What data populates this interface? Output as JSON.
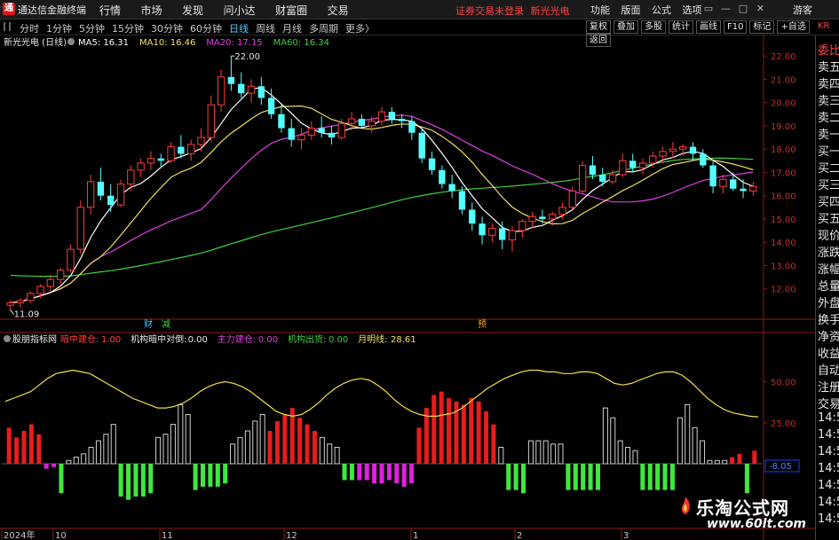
{
  "titlebar": {
    "app_name": "通达信金融终端",
    "logo_glyph": "通",
    "menu": [
      "行情",
      "市场",
      "发现",
      "问小达",
      "财富圈",
      "交易"
    ],
    "login_warning": "证券交易未登录",
    "stock_name": "新光光电",
    "right_menu": [
      "功能",
      "版面",
      "公式",
      "选项"
    ],
    "window_controls": [
      "▭",
      "—",
      "□",
      "✕"
    ],
    "guest": "游客"
  },
  "periodbar": {
    "periods": [
      "分时",
      "1分钟",
      "5分钟",
      "15分钟",
      "30分钟",
      "60分钟",
      "日线",
      "周线",
      "月线",
      "多周期",
      "更多〉"
    ],
    "active_period": "日线",
    "tools": [
      "复权",
      "叠加",
      "多股",
      "统计",
      "画线",
      "F10",
      "标记",
      "+自选",
      "返回"
    ]
  },
  "main_chart": {
    "stock_label": "新光光电 (日线)",
    "ma_labels": [
      {
        "text": "MA5: 16.31",
        "color": "#ffffff"
      },
      {
        "text": "MA10: 16.46",
        "color": "#f0e060"
      },
      {
        "text": "MA20: 17.15",
        "color": "#e040e0"
      },
      {
        "text": "MA60: 16.34",
        "color": "#40d040"
      }
    ],
    "high_label": "22.00",
    "low_label": "11.09",
    "event_markers": [
      {
        "text": "财",
        "color": "#4ec0ff"
      },
      {
        "text": "减",
        "color": "#40d040"
      },
      {
        "text": "预",
        "color": "#e8a020"
      }
    ],
    "y_ticks": [
      "22.00",
      "21.00",
      "20.00",
      "19.00",
      "18.00",
      "17.00",
      "16.00",
      "15.00",
      "14.00",
      "13.00",
      "12.00"
    ]
  },
  "indicator": {
    "name": "股朋指标网",
    "items": [
      {
        "label": "暗中建仓:",
        "value": "1.00",
        "color": "#ff4040"
      },
      {
        "label": "机构暗中对倒:",
        "value": "0.00",
        "color": "#e6e6e6"
      },
      {
        "label": "主力建仓:",
        "value": "0.00",
        "color": "#e040e0"
      },
      {
        "label": "机构出货:",
        "value": "0.00",
        "color": "#40d040"
      },
      {
        "label": "月明线:",
        "value": "28.61",
        "color": "#f0e060"
      }
    ],
    "y_ticks": [
      "50.00",
      "25.00"
    ],
    "current_value": "-8.05"
  },
  "x_axis": [
    "2024年",
    "10",
    "11",
    "12",
    "1",
    "2",
    "3"
  ],
  "side_panel": {
    "kr_label": "KR",
    "items": [
      {
        "text": "委比",
        "red": true
      },
      {
        "text": "卖五",
        "red": false
      },
      {
        "text": "卖四",
        "red": false
      },
      {
        "text": "卖三",
        "red": false
      },
      {
        "text": "卖二",
        "red": false
      },
      {
        "text": "卖一",
        "red": false
      },
      {
        "text": "买一",
        "red": false
      },
      {
        "text": "买二",
        "red": false
      },
      {
        "text": "买三",
        "red": false
      },
      {
        "text": "买四",
        "red": false
      },
      {
        "text": "买五",
        "red": false
      },
      {
        "text": "现价",
        "red": false
      },
      {
        "text": "涨跌",
        "red": false
      },
      {
        "text": "涨幅",
        "red": false
      },
      {
        "text": "总量",
        "red": false
      },
      {
        "text": "外盘",
        "red": false
      },
      {
        "text": "换手",
        "red": false
      },
      {
        "text": "净资",
        "red": false
      },
      {
        "text": "收益",
        "red": false
      },
      {
        "text": "自动",
        "red": false
      },
      {
        "text": "注册",
        "red": false
      },
      {
        "text": "交易",
        "red": false
      },
      {
        "text": "14:54",
        "red": false
      },
      {
        "text": "14:54",
        "red": false
      },
      {
        "text": "14:54",
        "red": false
      },
      {
        "text": "14:54",
        "red": false
      },
      {
        "text": "14:55",
        "red": false
      },
      {
        "text": "14:55",
        "red": false
      },
      {
        "text": "14:55",
        "red": false
      }
    ]
  },
  "watermark": {
    "line1": "乐淘公式网",
    "line2": "www.60lt.com"
  },
  "chart_data": {
    "type": "candlestick",
    "y_range": [
      11.0,
      22.5
    ],
    "candles": [
      [
        11.3,
        11.5,
        11.1,
        11.4
      ],
      [
        11.4,
        11.6,
        11.2,
        11.5
      ],
      [
        11.5,
        11.9,
        11.4,
        11.8
      ],
      [
        11.8,
        12.2,
        11.6,
        12.1
      ],
      [
        12.1,
        12.6,
        11.9,
        12.4
      ],
      [
        12.4,
        12.9,
        12.2,
        12.8
      ],
      [
        12.8,
        13.9,
        12.7,
        13.7
      ],
      [
        13.7,
        15.8,
        13.5,
        15.5
      ],
      [
        15.5,
        16.9,
        15.2,
        16.6
      ],
      [
        16.6,
        17.2,
        15.8,
        16.0
      ],
      [
        16.0,
        16.5,
        15.3,
        15.6
      ],
      [
        15.6,
        16.7,
        15.5,
        16.5
      ],
      [
        16.5,
        17.3,
        16.2,
        17.1
      ],
      [
        17.1,
        17.6,
        16.8,
        17.4
      ],
      [
        17.4,
        17.9,
        17.1,
        17.6
      ],
      [
        17.6,
        17.8,
        17.2,
        17.5
      ],
      [
        17.5,
        18.3,
        17.4,
        18.1
      ],
      [
        18.1,
        18.6,
        17.6,
        17.8
      ],
      [
        17.8,
        18.4,
        17.5,
        18.2
      ],
      [
        18.2,
        18.9,
        17.9,
        18.5
      ],
      [
        18.5,
        20.3,
        18.3,
        19.9
      ],
      [
        19.9,
        21.4,
        19.6,
        21.1
      ],
      [
        21.1,
        22.0,
        20.5,
        20.8
      ],
      [
        20.8,
        21.3,
        20.2,
        20.4
      ],
      [
        20.4,
        21.0,
        20.0,
        20.7
      ],
      [
        20.7,
        21.1,
        19.9,
        20.2
      ],
      [
        20.2,
        20.6,
        19.3,
        19.5
      ],
      [
        19.5,
        19.9,
        18.7,
        18.9
      ],
      [
        18.9,
        19.3,
        18.1,
        18.4
      ],
      [
        18.4,
        18.9,
        18.0,
        18.6
      ],
      [
        18.6,
        19.2,
        18.4,
        18.9
      ],
      [
        18.9,
        19.4,
        18.5,
        18.7
      ],
      [
        18.7,
        19.0,
        18.2,
        18.5
      ],
      [
        18.5,
        19.3,
        18.4,
        19.1
      ],
      [
        19.1,
        19.6,
        18.8,
        19.3
      ],
      [
        19.3,
        19.5,
        18.9,
        19.0
      ],
      [
        19.0,
        19.4,
        18.7,
        19.2
      ],
      [
        19.2,
        19.8,
        19.0,
        19.6
      ],
      [
        19.6,
        19.8,
        19.1,
        19.3
      ],
      [
        19.3,
        19.5,
        18.9,
        19.2
      ],
      [
        19.2,
        19.4,
        18.4,
        18.7
      ],
      [
        18.7,
        18.9,
        17.4,
        17.6
      ],
      [
        17.6,
        17.9,
        16.9,
        17.1
      ],
      [
        17.1,
        17.3,
        16.3,
        16.5
      ],
      [
        16.5,
        16.9,
        15.9,
        16.2
      ],
      [
        16.2,
        16.4,
        15.2,
        15.4
      ],
      [
        15.4,
        15.7,
        14.5,
        14.8
      ],
      [
        14.8,
        15.1,
        13.9,
        14.3
      ],
      [
        14.3,
        14.8,
        14.0,
        14.6
      ],
      [
        14.6,
        14.9,
        13.7,
        14.1
      ],
      [
        14.1,
        14.7,
        13.6,
        14.5
      ],
      [
        14.5,
        15.0,
        14.2,
        14.9
      ],
      [
        14.9,
        15.3,
        14.6,
        15.1
      ],
      [
        15.1,
        15.4,
        14.8,
        15.0
      ],
      [
        15.0,
        15.3,
        14.7,
        15.2
      ],
      [
        15.2,
        15.7,
        15.0,
        15.5
      ],
      [
        15.5,
        16.4,
        15.4,
        16.2
      ],
      [
        16.2,
        17.5,
        16.1,
        17.3
      ],
      [
        17.3,
        17.7,
        16.7,
        16.9
      ],
      [
        16.9,
        17.2,
        16.4,
        16.6
      ],
      [
        16.6,
        17.1,
        16.5,
        16.9
      ],
      [
        16.9,
        17.8,
        16.8,
        17.5
      ],
      [
        17.5,
        17.8,
        17.0,
        17.2
      ],
      [
        17.2,
        17.6,
        16.9,
        17.4
      ],
      [
        17.4,
        17.9,
        17.2,
        17.7
      ],
      [
        17.7,
        18.1,
        17.4,
        17.9
      ],
      [
        17.9,
        18.3,
        17.6,
        18.0
      ],
      [
        18.0,
        18.2,
        17.7,
        18.1
      ],
      [
        18.1,
        18.3,
        17.5,
        17.8
      ],
      [
        17.8,
        18.0,
        17.2,
        17.3
      ],
      [
        17.3,
        17.5,
        16.1,
        16.4
      ],
      [
        16.4,
        16.9,
        16.1,
        16.7
      ],
      [
        16.7,
        17.0,
        16.2,
        16.3
      ],
      [
        16.3,
        16.7,
        15.9,
        16.2
      ],
      [
        16.2,
        16.6,
        16.0,
        16.4
      ]
    ],
    "ma5_last": 16.31,
    "ma10_last": 16.46,
    "ma20_last": 17.15,
    "ma60_last": 16.34,
    "indicator_range": [
      -20,
      60
    ],
    "bars": [
      {
        "v": 22,
        "c": "red"
      },
      {
        "v": 16,
        "c": "red"
      },
      {
        "v": 20,
        "c": "red"
      },
      {
        "v": 24,
        "c": "red"
      },
      {
        "v": 18,
        "c": "red"
      },
      {
        "v": -3,
        "c": "magenta"
      },
      {
        "v": -2,
        "c": "magenta"
      },
      {
        "v": -18,
        "c": "green"
      },
      {
        "v": 2,
        "c": "white"
      },
      {
        "v": 4,
        "c": "white"
      },
      {
        "v": 6,
        "c": "white"
      },
      {
        "v": 10,
        "c": "white"
      },
      {
        "v": 14,
        "c": "white"
      },
      {
        "v": 18,
        "c": "white"
      },
      {
        "v": 24,
        "c": "white"
      },
      {
        "v": -20,
        "c": "green"
      },
      {
        "v": -22,
        "c": "green"
      },
      {
        "v": -20,
        "c": "green"
      },
      {
        "v": -20,
        "c": "green"
      },
      {
        "v": -18,
        "c": "green"
      },
      {
        "v": 16,
        "c": "white"
      },
      {
        "v": 18,
        "c": "white"
      },
      {
        "v": 24,
        "c": "white"
      },
      {
        "v": 36,
        "c": "white"
      },
      {
        "v": 30,
        "c": "white"
      },
      {
        "v": -16,
        "c": "green"
      },
      {
        "v": -14,
        "c": "green"
      },
      {
        "v": -14,
        "c": "green"
      },
      {
        "v": -14,
        "c": "green"
      },
      {
        "v": -12,
        "c": "green"
      },
      {
        "v": 12,
        "c": "white"
      },
      {
        "v": 16,
        "c": "white"
      },
      {
        "v": 20,
        "c": "white"
      },
      {
        "v": 26,
        "c": "white"
      },
      {
        "v": 30,
        "c": "white"
      },
      {
        "v": 20,
        "c": "red"
      },
      {
        "v": 26,
        "c": "red"
      },
      {
        "v": 30,
        "c": "red"
      },
      {
        "v": 34,
        "c": "red"
      },
      {
        "v": 28,
        "c": "red"
      },
      {
        "v": 24,
        "c": "red"
      },
      {
        "v": 20,
        "c": "red"
      },
      {
        "v": 16,
        "c": "white"
      },
      {
        "v": 12,
        "c": "white"
      },
      {
        "v": 10,
        "c": "white"
      },
      {
        "v": -10,
        "c": "green"
      },
      {
        "v": -10,
        "c": "green"
      },
      {
        "v": -10,
        "c": "magenta"
      },
      {
        "v": -10,
        "c": "magenta"
      },
      {
        "v": -12,
        "c": "magenta"
      },
      {
        "v": -12,
        "c": "magenta"
      },
      {
        "v": -10,
        "c": "magenta"
      },
      {
        "v": -12,
        "c": "magenta"
      },
      {
        "v": -14,
        "c": "magenta"
      },
      {
        "v": -12,
        "c": "magenta"
      },
      {
        "v": 22,
        "c": "red"
      },
      {
        "v": 34,
        "c": "red"
      },
      {
        "v": 42,
        "c": "red"
      },
      {
        "v": 44,
        "c": "red"
      },
      {
        "v": 40,
        "c": "red"
      },
      {
        "v": 38,
        "c": "red"
      },
      {
        "v": 36,
        "c": "red"
      },
      {
        "v": 40,
        "c": "red"
      },
      {
        "v": 38,
        "c": "red"
      },
      {
        "v": 32,
        "c": "red"
      },
      {
        "v": 24,
        "c": "red"
      },
      {
        "v": 10,
        "c": "white"
      },
      {
        "v": -16,
        "c": "green"
      },
      {
        "v": -16,
        "c": "green"
      },
      {
        "v": -18,
        "c": "green"
      },
      {
        "v": 14,
        "c": "white"
      },
      {
        "v": 14,
        "c": "white"
      },
      {
        "v": 14,
        "c": "white"
      },
      {
        "v": 12,
        "c": "white"
      },
      {
        "v": 12,
        "c": "white"
      },
      {
        "v": -16,
        "c": "green"
      },
      {
        "v": -16,
        "c": "green"
      },
      {
        "v": -16,
        "c": "green"
      },
      {
        "v": -16,
        "c": "green"
      },
      {
        "v": -16,
        "c": "green"
      },
      {
        "v": 34,
        "c": "white"
      },
      {
        "v": 28,
        "c": "white"
      },
      {
        "v": 14,
        "c": "white"
      },
      {
        "v": 10,
        "c": "white"
      },
      {
        "v": 8,
        "c": "white"
      },
      {
        "v": -16,
        "c": "green"
      },
      {
        "v": -16,
        "c": "green"
      },
      {
        "v": -16,
        "c": "green"
      },
      {
        "v": -16,
        "c": "green"
      },
      {
        "v": -16,
        "c": "green"
      },
      {
        "v": 28,
        "c": "white"
      },
      {
        "v": 36,
        "c": "white"
      },
      {
        "v": 22,
        "c": "white"
      },
      {
        "v": 14,
        "c": "white"
      },
      {
        "v": 2,
        "c": "white"
      },
      {
        "v": 2,
        "c": "white"
      },
      {
        "v": 2,
        "c": "white"
      },
      {
        "v": 4,
        "c": "red"
      },
      {
        "v": 6,
        "c": "red"
      },
      {
        "v": -18,
        "c": "green"
      },
      {
        "v": 8,
        "c": "red"
      }
    ],
    "yue_ming_xian": [
      38,
      40,
      42,
      44,
      48,
      52,
      55,
      56,
      57,
      56,
      55,
      52,
      49,
      46,
      43,
      40,
      38,
      36,
      34,
      34,
      35,
      37,
      40,
      44,
      47,
      49,
      50,
      49,
      47,
      44,
      40,
      36,
      32,
      30,
      29,
      30,
      33,
      37,
      42,
      46,
      49,
      51,
      52,
      51,
      48,
      44,
      39,
      35,
      32,
      30,
      29,
      29,
      30,
      31,
      34,
      38,
      42,
      46,
      49,
      52,
      54,
      56,
      57,
      57,
      56,
      56,
      55,
      55,
      56,
      56,
      55,
      52,
      49,
      48,
      49,
      51,
      53,
      55,
      56,
      56,
      54,
      50,
      45,
      40,
      36,
      33,
      31,
      30,
      29,
      28.61
    ]
  }
}
